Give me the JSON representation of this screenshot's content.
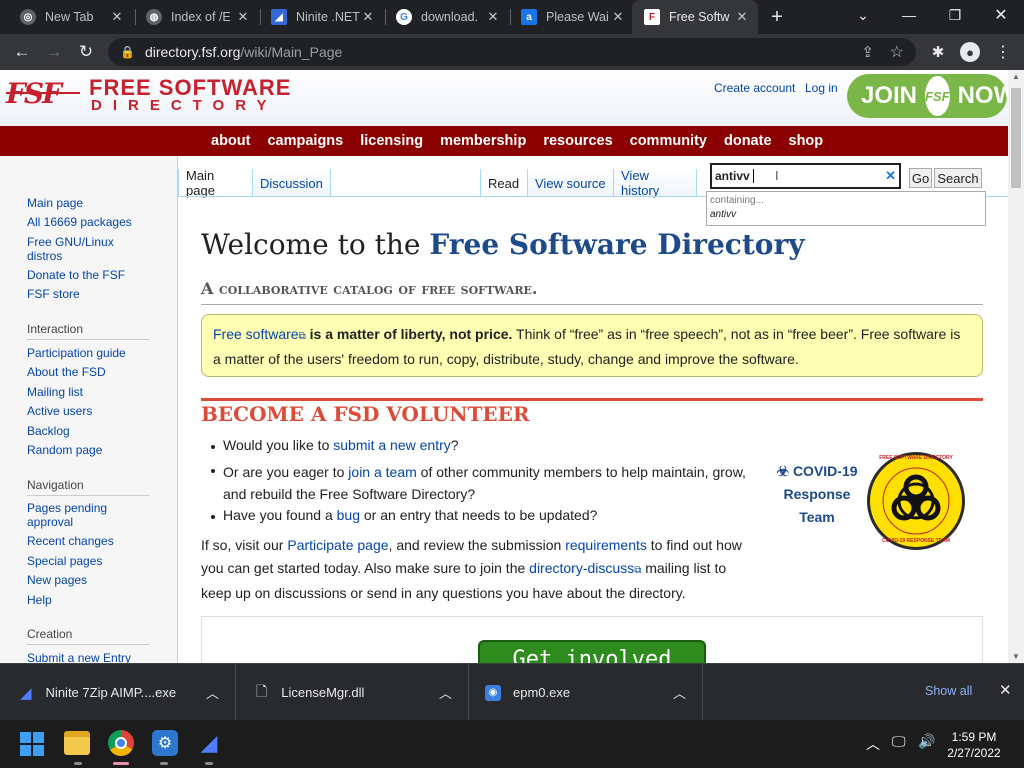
{
  "browser": {
    "tabs": [
      {
        "title": "New Tab"
      },
      {
        "title": "Index of /E"
      },
      {
        "title": "Ninite .NET"
      },
      {
        "title": "download."
      },
      {
        "title": "Please Wai"
      },
      {
        "title": "Free Softw"
      }
    ],
    "url_host": "directory.fsf.org",
    "url_path": "/wiki/Main_Page"
  },
  "site": {
    "logo_line1": "FREE SOFTWARE",
    "logo_line2": "DIRECTORY",
    "logo_mark": "FSF",
    "create_account": "Create account",
    "log_in": "Log in",
    "join_left": "JOIN",
    "join_mark": "FSF",
    "join_right": "NOW",
    "nav": [
      "about",
      "campaigns",
      "licensing",
      "membership",
      "resources",
      "community",
      "donate",
      "shop"
    ]
  },
  "sidebar": {
    "main_links": [
      "Main page",
      "All 16669 packages",
      "Free GNU/Linux distros",
      "Donate to the FSF",
      "FSF store"
    ],
    "interaction_title": "Interaction",
    "interaction_links": [
      "Participation guide",
      "About the FSD",
      "Mailing list",
      "Active users",
      "Backlog",
      "Random page"
    ],
    "navigation_title": "Navigation",
    "navigation_links": [
      "Pages pending approval",
      "Recent changes",
      "Special pages",
      "New pages",
      "Help"
    ],
    "creation_title": "Creation",
    "creation_links": [
      "Submit a new Entry"
    ]
  },
  "page_tabs": {
    "main_page": "Main page",
    "discussion": "Discussion",
    "read": "Read",
    "view_source": "View source",
    "view_history": "View history"
  },
  "search": {
    "value": "antivv",
    "go": "Go",
    "search": "Search",
    "suggest_containing": "containing...",
    "suggest_item": "antivv"
  },
  "content": {
    "welcome_prefix": "Welcome to the ",
    "welcome_bold": "Free Software Directory",
    "subtitle": "A collaborative catalog of free software.",
    "notice_link": "Free software",
    "notice_bold": " is a matter of liberty, not price.",
    "notice_line1": " Think of “free” as in “free speech”, not as in “free beer”. Free software is",
    "notice_line2": "a matter of the users' freedom to run, copy, distribute, study, change and improve the software.",
    "volunteer_heading": "Become a FSD volunteer",
    "b1_pre": "Would you like to ",
    "b1_link": "submit a new entry",
    "b1_post": "?",
    "b2_pre": "Or are you eager to ",
    "b2_link": "join a team",
    "b2_post": " of other community members to help maintain, grow,",
    "b2_line2": "and rebuild the Free Software Directory?",
    "b3_pre": "Have you found a ",
    "b3_link": "bug",
    "b3_post": " or an entry that needs to be updated?",
    "p1_pre": "If so, visit our ",
    "p1_link1": "Participate page",
    "p1_mid": ", and review the submission ",
    "p1_link2": "requirements",
    "p1_post": " to find out how",
    "p2_pre": "you can get started today. Also make sure to join the ",
    "p2_link": "directory-discuss",
    "p2_post": " mailing list to",
    "p3": "keep up on discussions or send in any questions you have about the directory.",
    "covid_line1": "COVID-19",
    "covid_line2": "Response",
    "covid_line3": "Team",
    "badge_top": "FREE SOFTWARE DIRECTORY",
    "badge_bottom": "COVID-19 RESPONSE TEAM",
    "get_involved": "Get involved"
  },
  "downloads": {
    "items": [
      "Ninite 7Zip AIMP....exe",
      "LicenseMgr.dll",
      "epm0.exe"
    ],
    "show_all": "Show all"
  },
  "taskbar": {
    "time": "1:59 PM",
    "date": "2/27/2022"
  },
  "colors": {
    "fsf_red": "#c8202f",
    "nav_bar": "#8b0000",
    "link_blue": "#0645ad",
    "join_green": "#7ab648"
  }
}
